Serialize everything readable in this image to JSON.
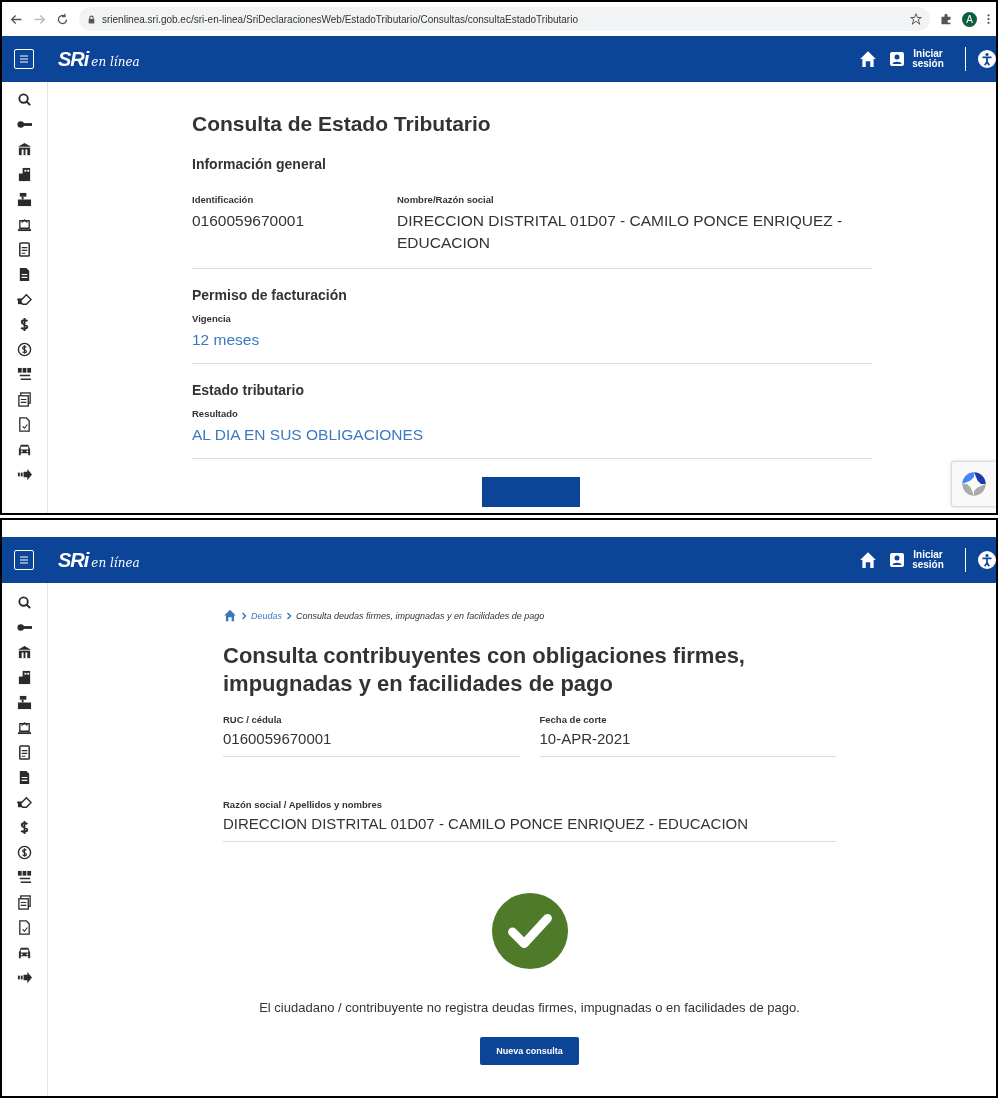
{
  "screens": [
    {
      "browser": {
        "url": "srienlinea.sri.gob.ec/sri-en-linea/SriDeclaracionesWeb/EstadoTributario/Consultas/consultaEstadoTributario",
        "profile_initial": "A"
      },
      "header": {
        "logo": "SRi",
        "logo_script": "en línea",
        "login": "Iniciar sesión"
      },
      "title": "Consulta de Estado Tributario",
      "sections": [
        {
          "heading": "Información general",
          "fields": [
            {
              "label": "Identificación",
              "value": "0160059670001",
              "kind": "plain"
            },
            {
              "label": "Nombre/Razón social",
              "value": "DIRECCION DISTRITAL 01D07 - CAMILO PONCE ENRIQUEZ - EDUCACION",
              "kind": "plain"
            }
          ]
        },
        {
          "heading": "Permiso de facturación",
          "fields": [
            {
              "label": "Vigencia",
              "value": "12 meses",
              "kind": "highlight"
            }
          ]
        },
        {
          "heading": "Estado tributario",
          "fields": [
            {
              "label": "Resultado",
              "value": "AL DIA EN SUS OBLIGACIONES",
              "kind": "highlight"
            }
          ]
        }
      ]
    },
    {
      "header": {
        "logo": "SRi",
        "logo_script": "en línea",
        "login": "Iniciar sesión"
      },
      "breadcrumb": [
        "Deudas",
        "Consulta deudas firmes, impugnadas y en facilidades de pago"
      ],
      "title": "Consulta contribuyentes con obligaciones firmes, impugnadas y en facilidades de pago",
      "fields": [
        {
          "label": "RUC / cédula",
          "value": "0160059670001",
          "wide": false
        },
        {
          "label": "Fecha de corte",
          "value": "10-APR-2021",
          "wide": false
        },
        {
          "label": "Razón social / Apellidos y nombres",
          "value": "DIRECCION DISTRITAL 01D07 - CAMILO PONCE ENRIQUEZ - EDUCACION",
          "wide": true
        }
      ],
      "message": "El ciudadano / contribuyente no registra deudas firmes, impugnadas o en facilidades de pago.",
      "button": "Nueva consulta"
    }
  ]
}
